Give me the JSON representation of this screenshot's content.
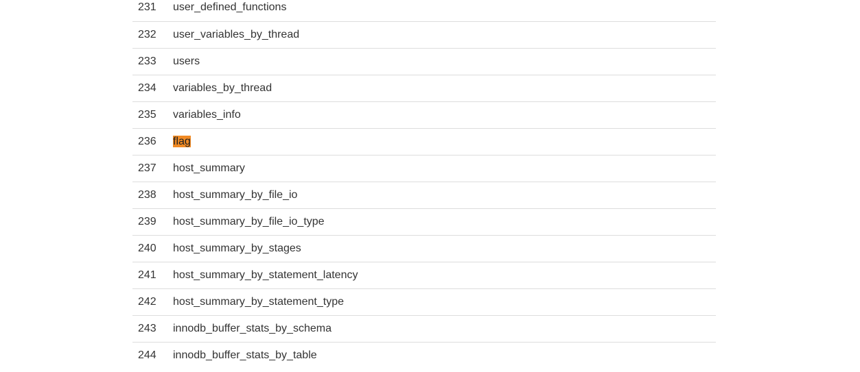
{
  "rows": [
    {
      "index": "231",
      "name": "user_defined_functions",
      "highlighted": false
    },
    {
      "index": "232",
      "name": "user_variables_by_thread",
      "highlighted": false
    },
    {
      "index": "233",
      "name": "users",
      "highlighted": false
    },
    {
      "index": "234",
      "name": "variables_by_thread",
      "highlighted": false
    },
    {
      "index": "235",
      "name": "variables_info",
      "highlighted": false
    },
    {
      "index": "236",
      "name": "flag",
      "highlighted": true
    },
    {
      "index": "237",
      "name": "host_summary",
      "highlighted": false
    },
    {
      "index": "238",
      "name": "host_summary_by_file_io",
      "highlighted": false
    },
    {
      "index": "239",
      "name": "host_summary_by_file_io_type",
      "highlighted": false
    },
    {
      "index": "240",
      "name": "host_summary_by_stages",
      "highlighted": false
    },
    {
      "index": "241",
      "name": "host_summary_by_statement_latency",
      "highlighted": false
    },
    {
      "index": "242",
      "name": "host_summary_by_statement_type",
      "highlighted": false
    },
    {
      "index": "243",
      "name": "innodb_buffer_stats_by_schema",
      "highlighted": false
    },
    {
      "index": "244",
      "name": "innodb_buffer_stats_by_table",
      "highlighted": false
    }
  ],
  "colors": {
    "highlight": "#f08a24",
    "row_border": "#dddddd",
    "text": "#333333"
  }
}
